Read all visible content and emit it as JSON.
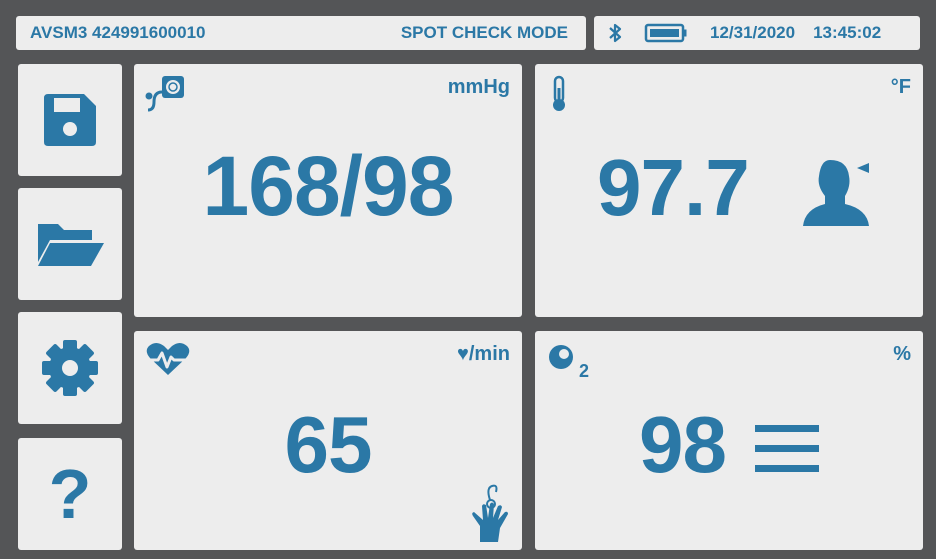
{
  "header": {
    "device_id": "AVSM3 424991600010",
    "mode": "SPOT CHECK MODE",
    "date": "12/31/2020",
    "time": "13:45:02",
    "bluetooth_icon": "bluetooth-icon",
    "battery_icon": "battery-icon"
  },
  "sidebar": {
    "items": [
      {
        "icon": "save-icon"
      },
      {
        "icon": "folder-open-icon"
      },
      {
        "icon": "gear-icon"
      },
      {
        "icon": "help-icon",
        "label": "?"
      }
    ]
  },
  "tiles": {
    "bp": {
      "value": "168/98",
      "unit": "mmHg",
      "icon": "bp-cuff-icon"
    },
    "temp": {
      "value": "97.7",
      "unit": "°F",
      "icon": "thermometer-icon",
      "site_icon": "head-forehead-icon"
    },
    "pulse": {
      "value": "65",
      "unit": "♥/min",
      "icon": "heart-pulse-icon",
      "source_icon": "hand-probe-icon"
    },
    "spo2": {
      "value": "98",
      "unit": "%",
      "icon": "o2-icon",
      "icon_label": "2",
      "extra_icon": "menu-lines-icon"
    }
  },
  "colors": {
    "accent": "#2b78a6",
    "panel": "#ededed",
    "background": "#545557"
  }
}
